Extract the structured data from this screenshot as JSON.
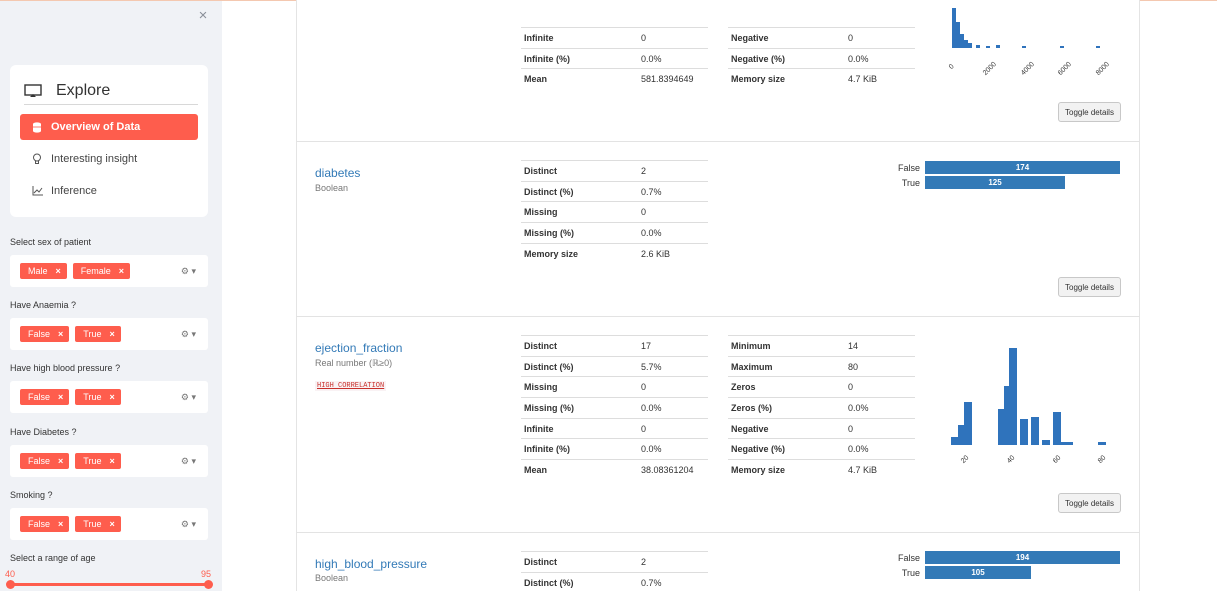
{
  "sidebar": {
    "close_glyph": "×",
    "nav_title": "Explore",
    "nav_title_icon": "monitor-icon",
    "nav_items": [
      {
        "label": "Overview of Data",
        "icon": "database-icon",
        "active": true
      },
      {
        "label": "Interesting insight",
        "icon": "lightbulb-icon",
        "active": false
      },
      {
        "label": "Inference",
        "icon": "line-chart-icon",
        "active": false
      }
    ],
    "filters": [
      {
        "label": "Select sex of patient",
        "tags": [
          "Male",
          "Female"
        ]
      },
      {
        "label": "Have Anaemia ?",
        "tags": [
          "False",
          "True"
        ]
      },
      {
        "label": "Have high blood pressure ?",
        "tags": [
          "False",
          "True"
        ]
      },
      {
        "label": "Have Diabetes ?",
        "tags": [
          "False",
          "True"
        ]
      },
      {
        "label": "Smoking ?",
        "tags": [
          "False",
          "True"
        ]
      }
    ],
    "tag_remove_glyph": "×",
    "control_glyph": "⚙ ▾",
    "age": {
      "label": "Select a range of age",
      "min": "40",
      "max": "95"
    },
    "accent": "#fe5d4d"
  },
  "main": {
    "toggle_label": "Toggle details",
    "top_partial": {
      "rows_left": [
        {
          "k": "Infinite",
          "v": "0"
        },
        {
          "k": "Infinite (%)",
          "v": "0.0%"
        },
        {
          "k": "Mean",
          "v": "581.8394649"
        }
      ],
      "rows_right": [
        {
          "k": "Negative",
          "v": "0"
        },
        {
          "k": "Negative (%)",
          "v": "0.0%"
        },
        {
          "k": "Memory size",
          "v": "4.7 KiB"
        }
      ],
      "hist_ticks": [
        "0",
        "2000",
        "4000",
        "6000",
        "8000"
      ]
    },
    "diabetes": {
      "name": "diabetes",
      "type": "Boolean",
      "rows": [
        {
          "k": "Distinct",
          "v": "2"
        },
        {
          "k": "Distinct (%)",
          "v": "0.7%"
        },
        {
          "k": "Missing",
          "v": "0"
        },
        {
          "k": "Missing (%)",
          "v": "0.0%"
        },
        {
          "k": "Memory size",
          "v": "2.6 KiB"
        }
      ],
      "bars": [
        {
          "label": "False",
          "count": "174",
          "value": 174
        },
        {
          "label": "True",
          "count": "125",
          "value": 125
        }
      ]
    },
    "ejection_fraction": {
      "name": "ejection_fraction",
      "type": "Real number (ℝ≥0)",
      "warning": "HIGH CORRELATION",
      "rows_left": [
        {
          "k": "Distinct",
          "v": "17"
        },
        {
          "k": "Distinct (%)",
          "v": "5.7%"
        },
        {
          "k": "Missing",
          "v": "0"
        },
        {
          "k": "Missing (%)",
          "v": "0.0%"
        },
        {
          "k": "Infinite",
          "v": "0"
        },
        {
          "k": "Infinite (%)",
          "v": "0.0%"
        },
        {
          "k": "Mean",
          "v": "38.08361204"
        }
      ],
      "rows_right": [
        {
          "k": "Minimum",
          "v": "14"
        },
        {
          "k": "Maximum",
          "v": "80"
        },
        {
          "k": "Zeros",
          "v": "0"
        },
        {
          "k": "Zeros (%)",
          "v": "0.0%"
        },
        {
          "k": "Negative",
          "v": "0"
        },
        {
          "k": "Negative (%)",
          "v": "0.0%"
        },
        {
          "k": "Memory size",
          "v": "4.7 KiB"
        }
      ],
      "hist_ticks": [
        "20",
        "40",
        "60",
        "80"
      ]
    },
    "high_blood_pressure": {
      "name": "high_blood_pressure",
      "type": "Boolean",
      "rows": [
        {
          "k": "Distinct",
          "v": "2"
        },
        {
          "k": "Distinct (%)",
          "v": "0.7%"
        }
      ],
      "bars": [
        {
          "label": "False",
          "count": "194",
          "value": 194
        },
        {
          "label": "True",
          "count": "105",
          "value": 105
        }
      ]
    }
  },
  "chart_data": [
    {
      "type": "bar",
      "title": "",
      "xlabel": "",
      "ylabel": "",
      "categories": [
        "False",
        "True"
      ],
      "values": [
        174,
        125
      ]
    },
    {
      "type": "bar",
      "title": "",
      "xlabel": "",
      "ylabel": "",
      "categories": [
        "False",
        "True"
      ],
      "values": [
        194,
        105
      ]
    },
    {
      "type": "bar",
      "title": "",
      "xlabel": "",
      "ylabel": "",
      "x": [
        14,
        17,
        20,
        25,
        30,
        35,
        38,
        40,
        45,
        50,
        55,
        60,
        62,
        65,
        70,
        80
      ],
      "values": [
        3,
        8,
        17,
        0,
        0,
        14,
        23,
        38,
        10,
        11,
        2,
        13,
        1,
        1,
        0,
        1
      ],
      "xticks": [
        "20",
        "40",
        "60",
        "80"
      ],
      "xlim": [
        14,
        80
      ]
    }
  ]
}
